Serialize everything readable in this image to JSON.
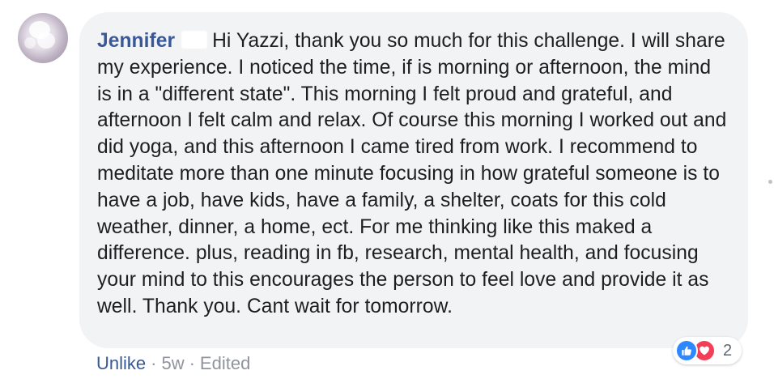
{
  "comment": {
    "author": "Jennifer",
    "text": "Hi Yazzi, thank you so much for this challenge. I will share my experience. I noticed the time, if is morning or afternoon, the mind is in a \"different state\". This morning I felt proud and grateful, and afternoon I felt calm and relax. Of course this morning I worked out and did yoga, and this afternoon I came tired from work. I recommend to meditate more than one minute focusing in how grateful someone is to have a job, have kids, have a family, a shelter, coats for this cold weather, dinner, a home, ect. For me thinking like this maked a difference. plus, reading in fb, research, mental health, and focusing your mind to this encourages the person to feel love and provide it as well. Thank you. Cant wait for tomorrow."
  },
  "reactions": {
    "count": "2",
    "icons": [
      "like-icon",
      "love-icon"
    ],
    "like_color": "#2d88ff",
    "love_color": "#f33e58"
  },
  "actions": {
    "unlike": "Unlike",
    "separator": "·",
    "time": "5w",
    "edited": "Edited"
  },
  "colors": {
    "link": "#385898",
    "bubble": "#f2f3f5",
    "text": "#1c1e21",
    "meta": "#90949c"
  }
}
